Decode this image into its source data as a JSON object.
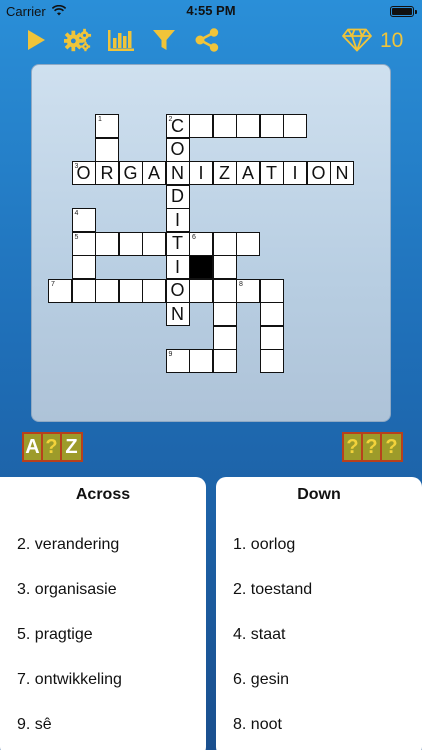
{
  "status": {
    "carrier": "Carrier",
    "time": "4:55 PM"
  },
  "toolbar": {
    "gems": "10"
  },
  "colors": {
    "accent": "#f0c43a",
    "hint_border": "#b8401c",
    "hint_bg": "#9d9b2a"
  },
  "hints": {
    "letter_hint": [
      "A",
      "?",
      "Z"
    ],
    "word_hint": [
      "?",
      "?",
      "?"
    ]
  },
  "across": {
    "title": "Across",
    "clues": [
      "2. verandering",
      "3. organisasie",
      "5. pragtige",
      "7. ontwikkeling",
      "9. sê"
    ]
  },
  "down": {
    "title": "Down",
    "clues": [
      "1. oorlog",
      "2. toestand",
      "4. staat",
      "6. gesin",
      "8. noot"
    ]
  },
  "grid": {
    "letters": {
      "r0c5": "C",
      "r1c5": "O",
      "r2c1": "O",
      "r2c2": "R",
      "r2c3": "G",
      "r2c4": "A",
      "r2c5": "N",
      "r2c6": "I",
      "r2c7": "Z",
      "r2c8": "A",
      "r2c9": "T",
      "r2c10": "I",
      "r2c11": "O",
      "r2c12": "N",
      "r3c5": "D",
      "r4c5": "I",
      "r5c5": "T",
      "r6c5": "I",
      "r7c5": "O",
      "r8c5": "N"
    },
    "numbers": {
      "r0c2": "1",
      "r0c5": "2",
      "r2c1": "3",
      "r4c1": "4",
      "r5c1": "5",
      "r5c6": "6",
      "r7c0": "7",
      "r7c8": "8",
      "r10c5": "9"
    }
  }
}
